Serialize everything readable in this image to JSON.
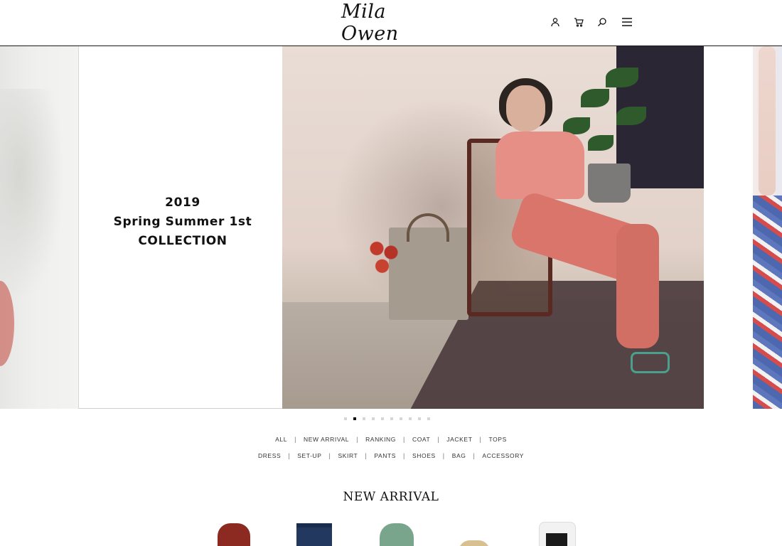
{
  "header": {
    "logo_text": "Mila Owen",
    "icons": [
      "user-icon",
      "cart-icon",
      "search-icon",
      "menu-icon"
    ]
  },
  "hero": {
    "collection_year": "2019",
    "collection_season": "Spring Summer 1st",
    "collection_label": "COLLECTION",
    "active_slide": 2,
    "slide_count": 10
  },
  "category_nav": {
    "row1": [
      "ALL",
      "NEW ARRIVAL",
      "RANKING",
      "COAT",
      "JACKET",
      "TOPS"
    ],
    "row2": [
      "DRESS",
      "SET-UP",
      "SKIRT",
      "PANTS",
      "SHOES",
      "BAG",
      "ACCESSORY"
    ]
  },
  "new_arrival": {
    "title": "NEW ARRIVAL"
  },
  "colors": {
    "header_border": "#1a1a1a",
    "dot_active": "#111111",
    "dot_inactive": "#d6d6d6"
  }
}
